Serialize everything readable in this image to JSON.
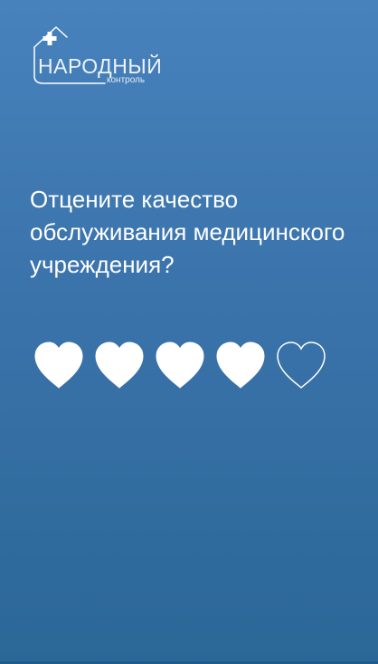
{
  "logo": {
    "title": "НАРОДНЫЙ",
    "subtitle": "контроль",
    "icon": "house-plus-icon"
  },
  "question": {
    "text": "Отцените качество обслуживания медицинского учреждения?"
  },
  "rating": {
    "max": 5,
    "value": 4,
    "icon": "heart-icon",
    "color": "#ffffff"
  },
  "colors": {
    "background_top": "#4882bd",
    "background_bottom": "#2b6797"
  }
}
